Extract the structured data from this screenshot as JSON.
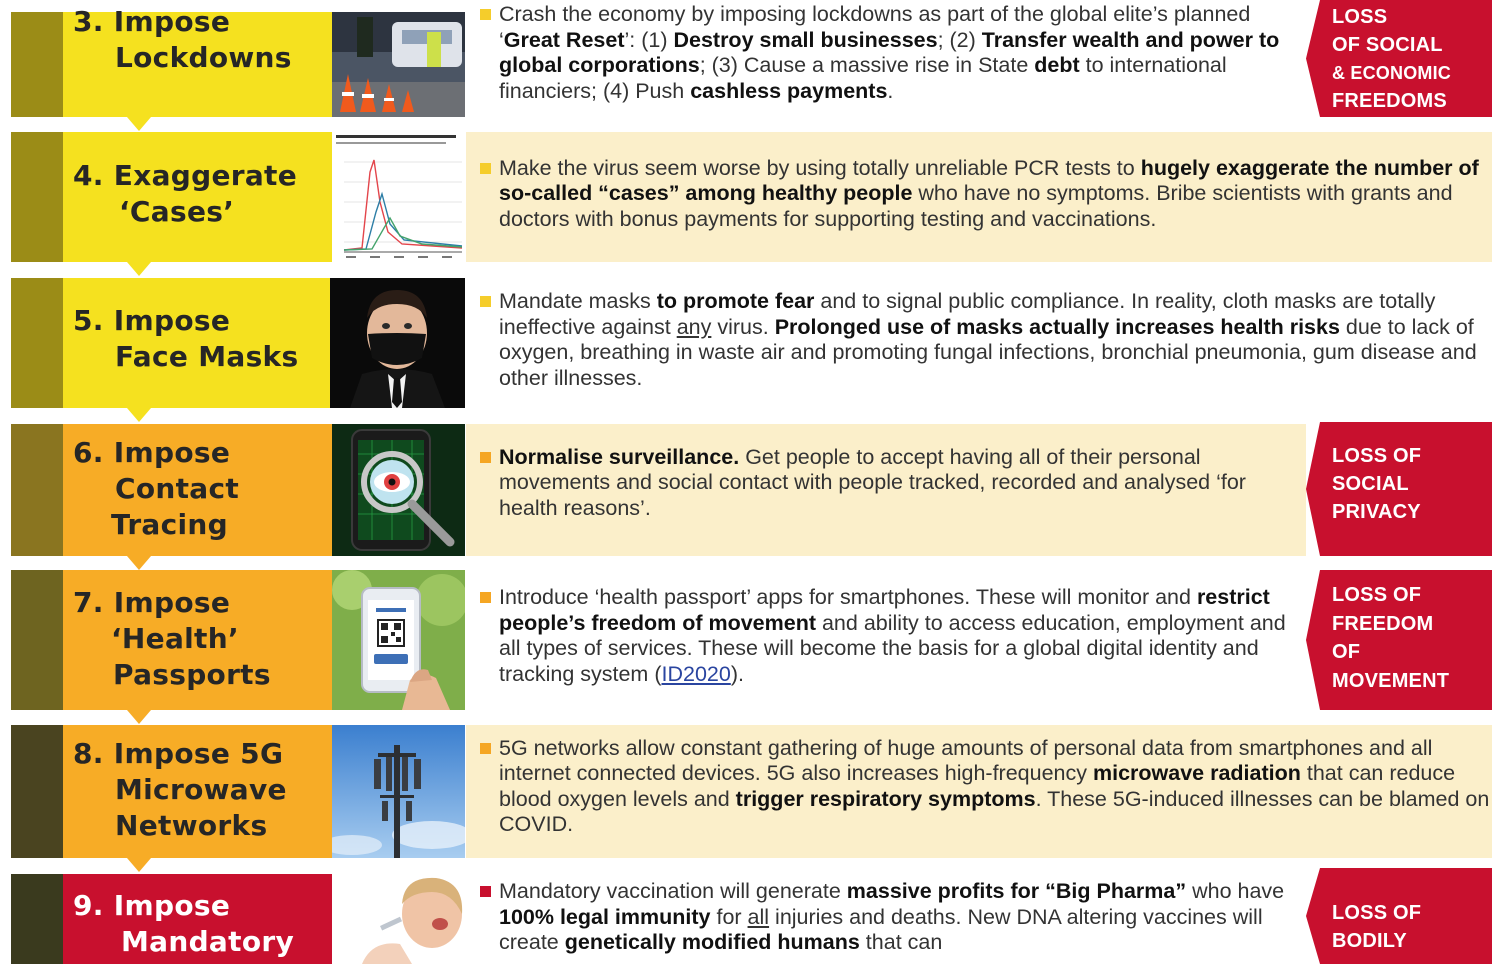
{
  "rows": [
    {
      "num": "3.",
      "title": [
        "Impose",
        "Lockdowns"
      ],
      "text": "Crash the economy by imposing lockdowns as part of the global elite’s planned ‘Great Reset’: (1) Destroy small businesses; (2) Transfer wealth and power to global corporations; (3) Cause a massive rise in State debt to international financiers; (4) Push cashless payments.",
      "tag": [
        "LOSS",
        "OF SOCIAL",
        "& ECONOMIC",
        "FREEDOMS"
      ],
      "photo": "police-checkpoint-photo"
    },
    {
      "num": "4.",
      "title": [
        "Exaggerate",
        "‘Cases’"
      ],
      "text": "Make the virus seem worse by using totally unreliable PCR tests to hugely exaggerate the number of so-called “cases” among healthy people who have no symptoms. Bribe scientists with grants and doctors with bonus payments for supporting testing and vaccinations.",
      "photo": "hospitalisation-line-chart"
    },
    {
      "num": "5.",
      "title": [
        "Impose",
        "Face Masks"
      ],
      "text": "Mandate masks to promote fear and to signal public compliance. In reality, cloth masks are totally ineffective against any virus. Prolonged use of masks actually increases health risks due to lack of oxygen, breathing in waste air and promoting fungal infections, bronchial pneumonia, gum disease and other illnesses.",
      "photo": "masked-man-photo"
    },
    {
      "num": "6.",
      "title": [
        "Impose",
        "Contact",
        "Tracing"
      ],
      "text": "Normalise surveillance. Get people to accept having all of their personal movements and social contact with people tracked, recorded and analysed ‘for health reasons’.",
      "tag": [
        "LOSS OF",
        "SOCIAL",
        "PRIVACY"
      ],
      "photo": "phone-eye-magnifier-photo"
    },
    {
      "num": "7.",
      "title": [
        "Impose",
        "‘Health’",
        "Passports"
      ],
      "text": "Introduce ‘health passport’ apps for smartphones. These will monitor and restrict people’s freedom of movement and ability to access education, employment and all types of services. These will become the basis for a global digital identity and tracking system (ID2020).",
      "link": "ID2020",
      "tag": [
        "LOSS OF",
        "FREEDOM",
        "OF",
        "MOVEMENT"
      ],
      "photo": "phone-qr-code-photo"
    },
    {
      "num": "8.",
      "title": [
        "Impose 5G",
        "Microwave",
        "Networks"
      ],
      "text": "5G networks allow constant gathering of huge amounts of personal data from smartphones and all internet connected devices. 5G also increases high-frequency microwave radiation that can reduce blood oxygen levels and trigger respiratory symptoms. These 5G-induced illnesses can be blamed on COVID.",
      "photo": "5g-tower-photo"
    },
    {
      "num": "9.",
      "title": [
        "Impose",
        "Mandatory"
      ],
      "text": "Mandatory vaccination will generate massive profits for “Big Pharma” who have 100% legal immunity for all injuries and deaths. New DNA altering vaccines will create genetically modified humans that can",
      "tag": [
        "LOSS OF",
        "BODILY"
      ],
      "photo": "child-vaccination-photo"
    }
  ],
  "colors": {
    "yellow": "#f5e11f",
    "orange": "#f7ac26",
    "red": "#c8102e",
    "cream": "#fbefca"
  }
}
